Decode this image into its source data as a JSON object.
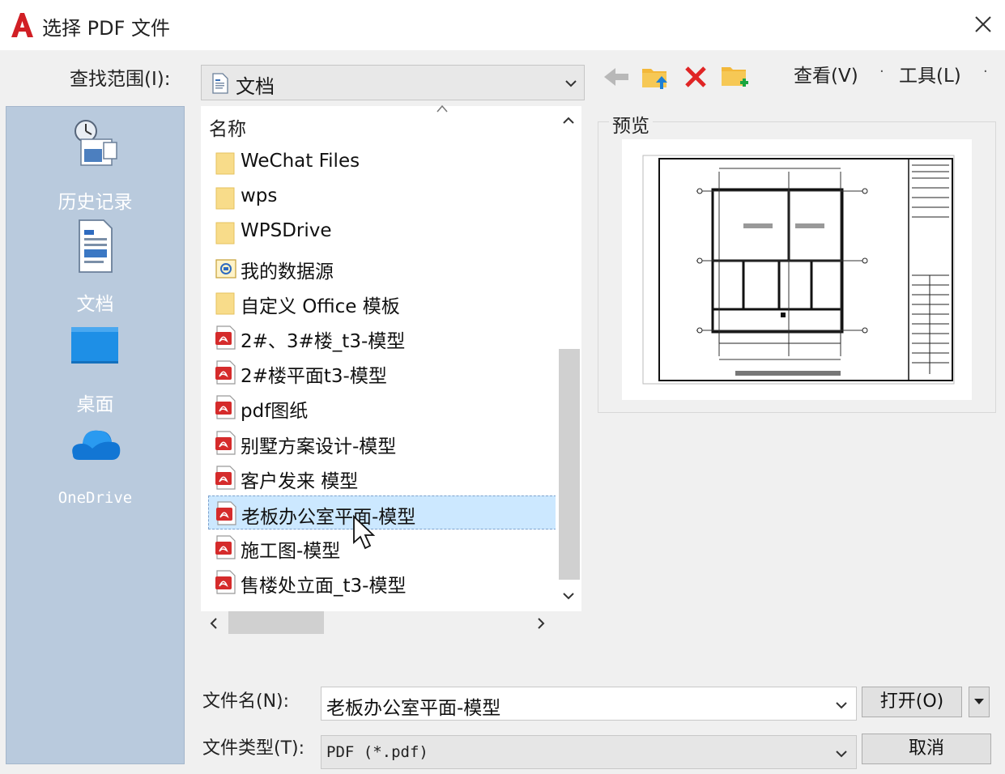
{
  "window": {
    "title": "选择 PDF 文件"
  },
  "toolbar": {
    "lookin_label": "查找范围(I):",
    "lookin_value": "文档",
    "view_label": "查看(V)",
    "tools_label": "工具(L)"
  },
  "places": [
    {
      "label": "历史记录"
    },
    {
      "label": "文档"
    },
    {
      "label": "桌面"
    },
    {
      "label": "OneDrive"
    }
  ],
  "filelist": {
    "column_header": "名称",
    "items": [
      {
        "name": "WeChat Files",
        "type": "folder"
      },
      {
        "name": "wps",
        "type": "folder"
      },
      {
        "name": "WPSDrive",
        "type": "folder"
      },
      {
        "name": "我的数据源",
        "type": "datasource-folder"
      },
      {
        "name": "自定义 Office 模板",
        "type": "folder"
      },
      {
        "name": "2#、3#楼_t3-模型",
        "type": "pdf"
      },
      {
        "name": "2#楼平面t3-模型",
        "type": "pdf"
      },
      {
        "name": "pdf图纸",
        "type": "pdf"
      },
      {
        "name": "别墅方案设计-模型",
        "type": "pdf"
      },
      {
        "name": "客户发来 模型",
        "type": "pdf"
      },
      {
        "name": "老板办公室平面-模型",
        "type": "pdf",
        "selected": true
      },
      {
        "name": "施工图-模型",
        "type": "pdf"
      },
      {
        "name": "售楼处立面_t3-模型",
        "type": "pdf"
      }
    ]
  },
  "preview": {
    "label": "预览"
  },
  "filename": {
    "label": "文件名(N):",
    "value": "老板办公室平面-模型"
  },
  "filetype": {
    "label": "文件类型(T):",
    "value": "PDF (*.pdf)"
  },
  "buttons": {
    "open": "打开(O)",
    "cancel": "取消"
  },
  "colors": {
    "places_bg": "#b9cadd",
    "selection": "#cce8ff",
    "pdf_red": "#d52b2b",
    "folder": "#f5d36e"
  }
}
